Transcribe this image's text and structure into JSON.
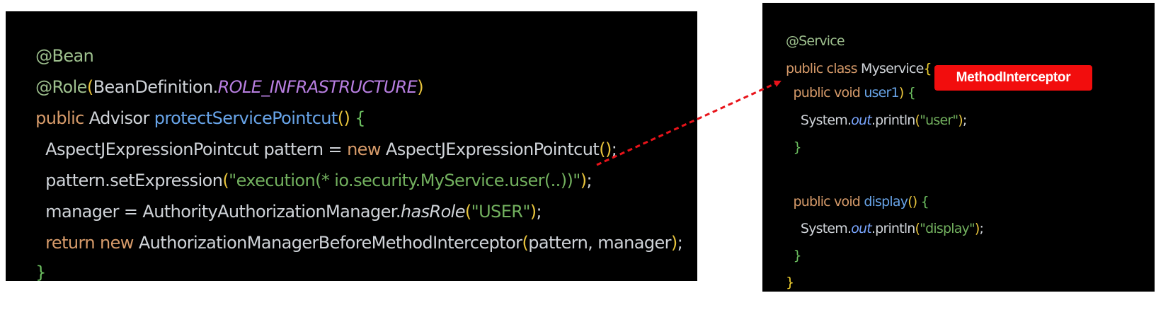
{
  "left_code": {
    "l1_ann": "@Bean",
    "l2_ann": "@Role",
    "l2_open": "(",
    "l2_plain": "BeanDefinition.",
    "l2_const": "ROLE_INFRASTRUCTURE",
    "l2_close": ")",
    "l3_kw": "public ",
    "l3_type": "Advisor ",
    "l3_fn": "protectServicePointcut",
    "l3_parens": "()",
    "l3_brace": " {",
    "l4_plain1": "  AspectJExpressionPointcut pattern = ",
    "l4_kw": "new ",
    "l4_plain2": "AspectJExpressionPointcut",
    "l4_parens": "()",
    "l4_semi": ";",
    "l5_plain": "  pattern.setExpression",
    "l5_open": "(",
    "l5_str": "\"execution(* io.security.MyService.user(..))\"",
    "l5_close": ")",
    "l5_semi": ";",
    "l6_plain": "  manager = AuthorityAuthorizationManager.",
    "l6_ital": "hasRole",
    "l6_open": "(",
    "l6_str": "\"USER\"",
    "l6_close": ")",
    "l6_semi": ";",
    "l7_kw": "  return new ",
    "l7_plain": "AuthorizationManagerBeforeMethodInterceptor",
    "l7_open": "(",
    "l7_args": "pattern, manager",
    "l7_close": ")",
    "l7_semi": ";",
    "l8_brace": "}"
  },
  "right_code": {
    "r1_ann": "@Service",
    "r2_kw": "public class ",
    "r2_plain": "Myservice",
    "r2_brace": "{",
    "r3_kw": "  public void ",
    "r3_fn": "user1",
    "r3_parens": ")",
    "r3_brace": " {",
    "r4_plain": "    System.",
    "r4_ital": "out",
    "r4_plain2": ".println",
    "r4_open": "(",
    "r4_str": "\"user\"",
    "r4_close": ")",
    "r4_semi": ";",
    "r5_brace": "  }",
    "r6_kw": "  public void ",
    "r6_fn": "display",
    "r6_parens": "()",
    "r6_brace": " {",
    "r7_plain": "    System.",
    "r7_ital": "out",
    "r7_plain2": ".println",
    "r7_open": "(",
    "r7_str": "\"display\"",
    "r7_close": ")",
    "r7_semi": ";",
    "r8_brace": "  }",
    "r9_brace": "}"
  },
  "badge": {
    "label": "MethodInterceptor"
  },
  "colors": {
    "background": "#000000",
    "badge": "#f20d0d",
    "arrow": "#e8131a"
  }
}
